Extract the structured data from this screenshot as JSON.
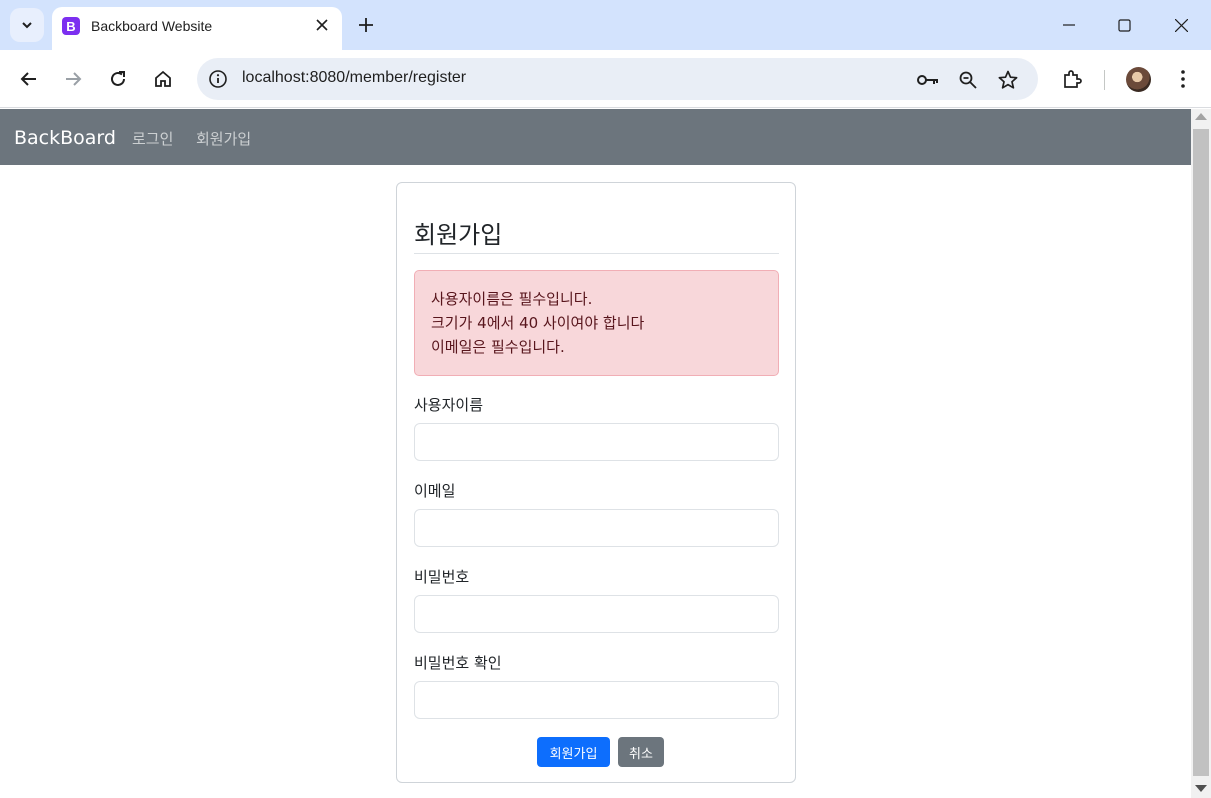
{
  "browser": {
    "tab_title": "Backboard Website",
    "favicon_letter": "B",
    "url": "localhost:8080/member/register"
  },
  "navbar": {
    "brand": "BackBoard",
    "links": [
      "로그인",
      "회원가입"
    ]
  },
  "form": {
    "title": "회원가입",
    "errors": [
      "사용자이름은 필수입니다.",
      "크기가 4에서 40 사이여야 합니다",
      "이메일은 필수입니다."
    ],
    "fields": [
      {
        "label": "사용자이름",
        "value": ""
      },
      {
        "label": "이메일",
        "value": ""
      },
      {
        "label": "비밀번호",
        "value": ""
      },
      {
        "label": "비밀번호 확인",
        "value": ""
      }
    ],
    "submit_label": "회원가입",
    "cancel_label": "취소"
  },
  "colors": {
    "navbar_bg": "#6c757d",
    "primary": "#0d6efd",
    "secondary": "#6c757d",
    "alert_bg": "#f8d7da",
    "alert_text": "#58151c",
    "tabbar_bg": "#d3e3fd"
  }
}
